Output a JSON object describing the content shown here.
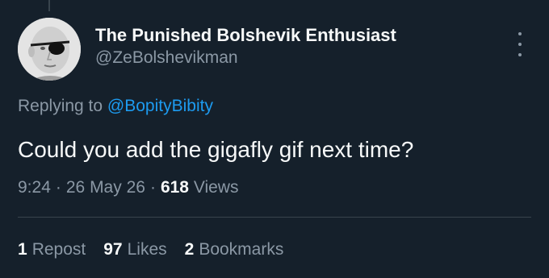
{
  "author": {
    "display_name": "The Punished Bolshevik Enthusiast",
    "handle": "@ZeBolshevikman",
    "avatar_icon": "bald-man-eyepatch-avatar"
  },
  "reply": {
    "prefix": "Replying to",
    "mention": "@BopityBibity"
  },
  "tweet": {
    "text": "Could you add the gigafly gif next time?"
  },
  "meta": {
    "time": "9:24",
    "separator": "·",
    "date": "26 May 26",
    "views_count": "618",
    "views_label": "Views"
  },
  "stats": {
    "reposts_count": "1",
    "reposts_label": "Repost",
    "likes_count": "97",
    "likes_label": "Likes",
    "bookmarks_count": "2",
    "bookmarks_label": "Bookmarks"
  },
  "colors": {
    "background": "#15202b",
    "primary_text": "#f7f9f9",
    "secondary_text": "#8b98a5",
    "accent": "#1d9bf0",
    "divider": "#38444d"
  },
  "icons": {
    "more": "more-vertical-icon"
  }
}
